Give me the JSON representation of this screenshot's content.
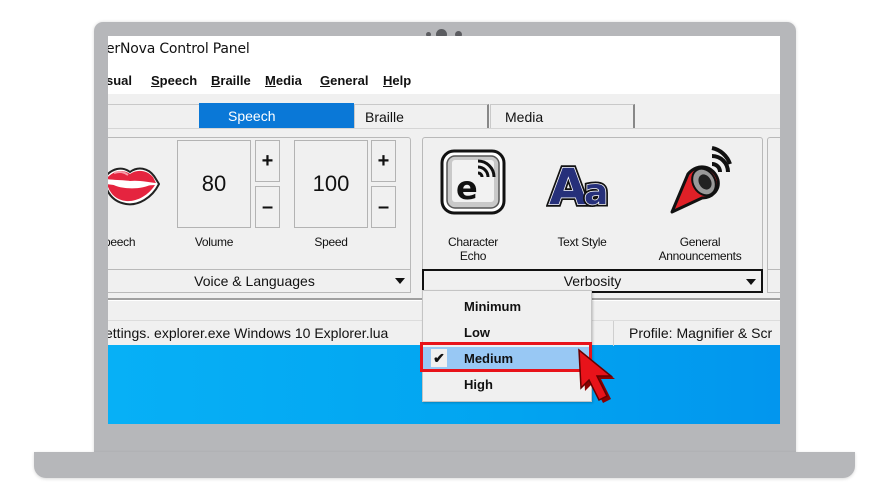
{
  "window": {
    "title": "erNova Control Panel"
  },
  "menubar": {
    "items": [
      {
        "label": "sual",
        "mnemonic": ""
      },
      {
        "label": "Speech",
        "mnemonic": "S"
      },
      {
        "label": "Braille",
        "mnemonic": "B"
      },
      {
        "label": "Media",
        "mnemonic": "M"
      },
      {
        "label": "General",
        "mnemonic": "G"
      },
      {
        "label": "Help",
        "mnemonic": "H"
      }
    ]
  },
  "tabs": {
    "items": [
      {
        "label": "",
        "active": false
      },
      {
        "label": "Speech",
        "active": true
      },
      {
        "label": "Braille",
        "active": false
      },
      {
        "label": "Media",
        "active": false
      }
    ]
  },
  "speech_group": {
    "speech_label": "peech",
    "speech_icon": "lips-icon",
    "volume": {
      "label": "Volume",
      "value": "80",
      "plus": "+",
      "minus": "–"
    },
    "speed": {
      "label": "Speed",
      "value": "100",
      "plus": "+",
      "minus": "–"
    },
    "dropdown": "Voice & Languages"
  },
  "verbosity_group": {
    "items": [
      {
        "label_line1": "Character",
        "label_line2": "Echo",
        "icon": "character-echo-icon"
      },
      {
        "label_line1": "Text Style",
        "label_line2": "",
        "icon": "text-style-icon"
      },
      {
        "label_line1": "General",
        "label_line2": "Announcements",
        "icon": "megaphone-icon"
      }
    ],
    "dropdown": "Verbosity"
  },
  "statusbar": {
    "left": "ettings. explorer.exe Windows 10 Explorer.lua",
    "right": "Profile: Magnifier & Scr"
  },
  "verbosity_menu": {
    "options": [
      {
        "label": "Minimum",
        "selected": false
      },
      {
        "label": "Low",
        "selected": false
      },
      {
        "label": "Medium",
        "selected": true
      },
      {
        "label": "High",
        "selected": false
      }
    ],
    "check_glyph": "✔"
  },
  "colors": {
    "accent_tab": "#0a78d7",
    "selected_item": "#98c8f4",
    "highlight": "#e8131a",
    "desktop": "#02a4f0"
  }
}
